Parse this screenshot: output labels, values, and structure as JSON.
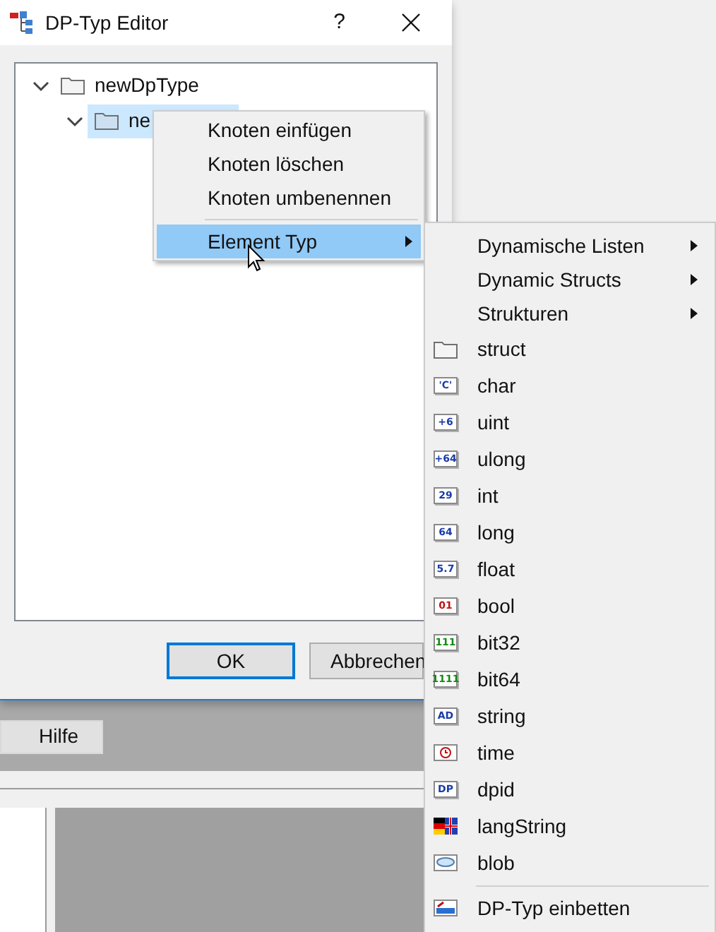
{
  "dialog": {
    "title": "DP-Typ Editor",
    "help_button": "?",
    "tree": [
      {
        "label": "newDpType",
        "expanded": true,
        "selected": false,
        "children": [
          {
            "label": "ne",
            "expanded": true,
            "selected": true
          }
        ]
      }
    ],
    "buttons": [
      {
        "label": "OK",
        "default": true
      },
      {
        "label": "Abbrechen",
        "default": false
      }
    ]
  },
  "background_window": {
    "buttons": [
      "Hilfe"
    ]
  },
  "context_menu": {
    "items": [
      {
        "kind": "item",
        "label": "Knoten einfügen",
        "highlighted": false
      },
      {
        "kind": "item",
        "label": "Knoten löschen",
        "highlighted": false
      },
      {
        "kind": "item",
        "label": "Knoten umbenennen",
        "highlighted": false
      },
      {
        "kind": "separator"
      },
      {
        "kind": "submenu",
        "label": "Element Typ",
        "highlighted": true
      }
    ]
  },
  "submenu": {
    "items": [
      {
        "kind": "submenu",
        "label": "Dynamische Listen"
      },
      {
        "kind": "submenu",
        "label": "Dynamic Structs"
      },
      {
        "kind": "submenu",
        "label": "Strukturen"
      },
      {
        "kind": "folder",
        "label": "struct"
      },
      {
        "kind": "badge",
        "badge": "'C'",
        "color": "#1a3caa",
        "label": "char"
      },
      {
        "kind": "badge",
        "badge": "+6",
        "color": "#1a3caa",
        "label": "uint"
      },
      {
        "kind": "badge",
        "badge": "+64",
        "color": "#1a3caa",
        "label": "ulong"
      },
      {
        "kind": "badge",
        "badge": "29",
        "color": "#1a3caa",
        "label": "int"
      },
      {
        "kind": "badge",
        "badge": "64",
        "color": "#1a3caa",
        "label": "long"
      },
      {
        "kind": "badge",
        "badge": "5.7",
        "color": "#1a3caa",
        "label": "float"
      },
      {
        "kind": "badge",
        "badge": "01",
        "color": "#c01010",
        "label": "bool"
      },
      {
        "kind": "badge",
        "badge": "111",
        "color": "#108a10",
        "label": "bit32"
      },
      {
        "kind": "badge",
        "badge": "1111",
        "color": "#108a10",
        "label": "bit64"
      },
      {
        "kind": "badge",
        "badge": "AD",
        "color": "#1a3caa",
        "label": "string"
      },
      {
        "kind": "clock",
        "label": "time"
      },
      {
        "kind": "badge",
        "badge": "DP",
        "color": "#1a3caa",
        "label": "dpid"
      },
      {
        "kind": "flag",
        "label": "langString"
      },
      {
        "kind": "bubble",
        "label": "blob"
      },
      {
        "kind": "separator"
      },
      {
        "kind": "embed",
        "label": "DP-Typ einbetten"
      }
    ]
  }
}
